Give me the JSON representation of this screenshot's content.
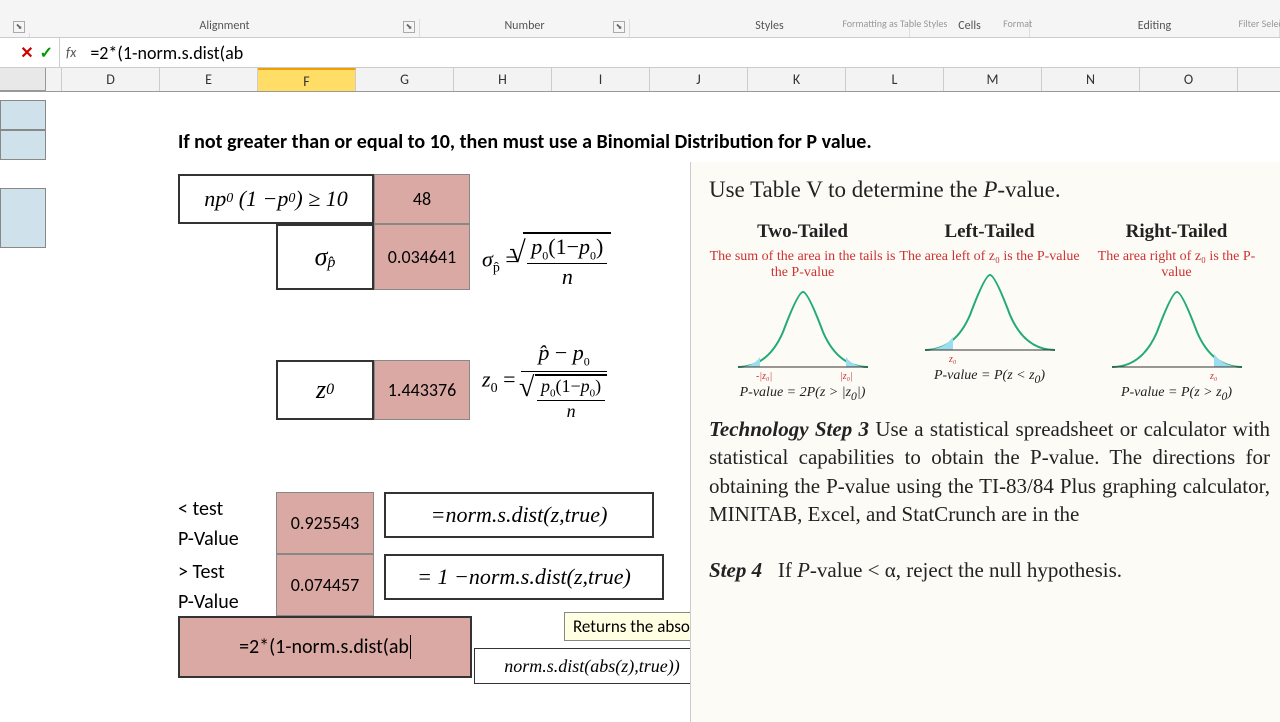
{
  "ribbon": {
    "groups": [
      "Alignment",
      "Number",
      "Styles",
      "Cells",
      "Editing"
    ],
    "top_hints": [
      "",
      "",
      "Formatting   as Table   Styles",
      "Format",
      "Filter   Select"
    ]
  },
  "formula_bar": {
    "cancel": "✕",
    "enter": "✓",
    "fx": "fx",
    "value": "=2*(1-norm.s.dist(ab"
  },
  "columns": [
    "D",
    "E",
    "F",
    "G",
    "H",
    "I",
    "J",
    "K",
    "L",
    "M",
    "N",
    "O"
  ],
  "active_col": "F",
  "title": "If not greater than or equal to 10, then must use a Binomial Distribution for P value.",
  "rows": {
    "np_expr": "np₀ (1 − p₀) ≥ 10",
    "np_val": "48",
    "sigma_label": "σp̂",
    "sigma_val": "0.034641",
    "sigma_formula": "σp̂ = √(p₀(1−p₀)/n)",
    "z_label": "z₀",
    "z_val": "1.443376",
    "z_formula": "z₀ = (p̂ − p₀) / √(p₀(1−p₀)/n)",
    "lt_label1": "< test",
    "lt_label2": "P-Value",
    "lt_val": "0.925543",
    "lt_formula": "= norm.s.dist(z, true)",
    "gt_label1": "> Test",
    "gt_label2": "P-Value",
    "gt_val": "0.074457",
    "gt_formula": "= 1 − norm.s.dist(z, true)",
    "edit_val": "=2*(1-norm.s.dist(ab",
    "two_tail_formula": "norm.s.dist(abs(z), true))"
  },
  "tooltip": "Returns the absolute value of a number, a number without its sign",
  "overlay": {
    "header": "Use Table V to determine the P-value.",
    "col_titles": [
      "Two-Tailed",
      "Left-Tailed",
      "Right-Tailed"
    ],
    "col_subs": [
      "The sum of the area in the tails is the P-value",
      "The area left of z₀ is the P-value",
      "The area right of z₀ is the P-value"
    ],
    "pv_labels": [
      "P-value = 2P(z > |z₀|)",
      "P-value = P(z < z₀)",
      "P-value = P(z > z₀)"
    ],
    "tech_bold": "Technology Step 3",
    "tech_body": "  Use a statistical spreadsheet or calculator with statistical capabilities to obtain the P-value. The directions for obtaining the P-value using the TI-83/84 Plus graphing calculator, MINITAB, Excel, and StatCrunch are in the",
    "step4_bold": "Step 4",
    "step4_body": "   If P-value < α, reject the null hypothesis."
  }
}
